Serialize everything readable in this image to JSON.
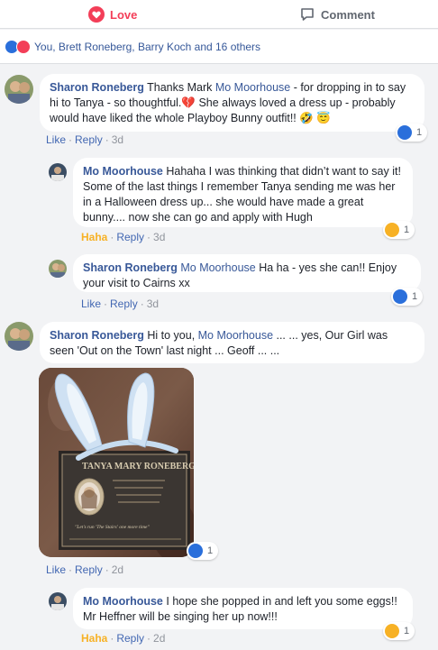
{
  "actions": {
    "love_label": "Love",
    "comment_label": "Comment"
  },
  "summary": {
    "text": "You, Brett Roneberg, Barry Koch and 16 others"
  },
  "comments": [
    {
      "author": "Sharon Roneberg",
      "before": "Thanks Mark ",
      "mention": "Mo Moorhouse",
      "after": " - for dropping in to say hi to Tanya - so thoughtful.",
      "emoji_heart": "💔",
      "after2": " She always loved a dress up - probably would have liked the whole Playboy Bunny outfit!! ",
      "emoji_end": "🤣 😇",
      "like": "Like",
      "reply": "Reply",
      "time": "3d",
      "reaction_count": "1"
    },
    {
      "author": "Mo Moorhouse",
      "text": "Hahaha I was thinking that didn’t want to say it! Some of the last things I remember Tanya sending me was her in a Halloween dress up... she would have made a great bunny.... now she can go and apply with Hugh",
      "reacted": "Haha",
      "reply": "Reply",
      "time": "3d",
      "reaction_count": "1"
    },
    {
      "author": "Sharon Roneberg",
      "mention": "Mo Moorhouse",
      "text": "Ha ha - yes she can!! Enjoy your visit to Cairns xx",
      "like": "Like",
      "reply": "Reply",
      "time": "3d",
      "reaction_count": "1"
    },
    {
      "author": "Sharon Roneberg",
      "before": "Hi to you, ",
      "mention": "Mo Moorhouse",
      "after": " ... ... yes, Our Girl was seen 'Out on the Town' last night ... Geoff ... ...",
      "like": "Like",
      "reply": "Reply",
      "time": "2d",
      "reaction_count": "1",
      "plaque_name": "TANYA MARY RONEBERG",
      "plaque_quote": "\"Let's run 'The Stairs' one more time\""
    },
    {
      "author": "Mo Moorhouse",
      "text": "I hope she popped in and left you some eggs!! Mr Heffner will be singing her up now!!!",
      "reacted": "Haha",
      "reply": "Reply",
      "time": "2d",
      "reaction_count": "1"
    }
  ],
  "colors": {
    "like_blue": "#2a6fdb",
    "love_red": "#f33e58",
    "haha_yellow": "#f7b125",
    "name_blue": "#385898"
  },
  "icons": [
    "heart-icon",
    "comment-icon",
    "like-icon",
    "love-icon",
    "haha-icon"
  ]
}
